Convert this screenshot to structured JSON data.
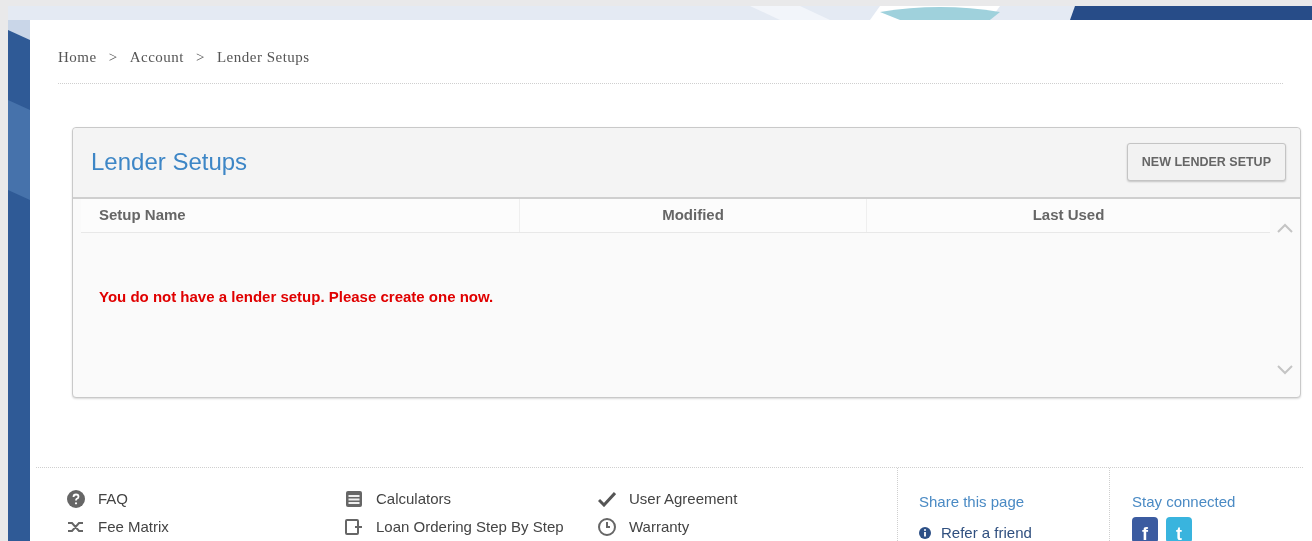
{
  "breadcrumb": {
    "items": [
      "Home",
      "Account",
      "Lender Setups"
    ],
    "separators": [
      ">",
      ">"
    ]
  },
  "panel": {
    "title": "Lender Setups",
    "button": "NEW LENDER SETUP",
    "columns": [
      "Setup Name",
      "Modified",
      "Last Used"
    ],
    "message": "You do not have a lender setup. Please create one now."
  },
  "footer": {
    "columns": [
      [
        {
          "label": "FAQ"
        },
        {
          "label": "Fee Matrix"
        }
      ],
      [
        {
          "label": "Calculators"
        },
        {
          "label": "Loan Ordering Step By Step"
        }
      ],
      [
        {
          "label": "User Agreement"
        },
        {
          "label": "Warranty"
        }
      ]
    ],
    "share": {
      "title": "Share this page",
      "links": [
        "Refer a friend"
      ]
    },
    "connect": {
      "title": "Stay connected",
      "social": [
        "f",
        "t"
      ]
    }
  }
}
